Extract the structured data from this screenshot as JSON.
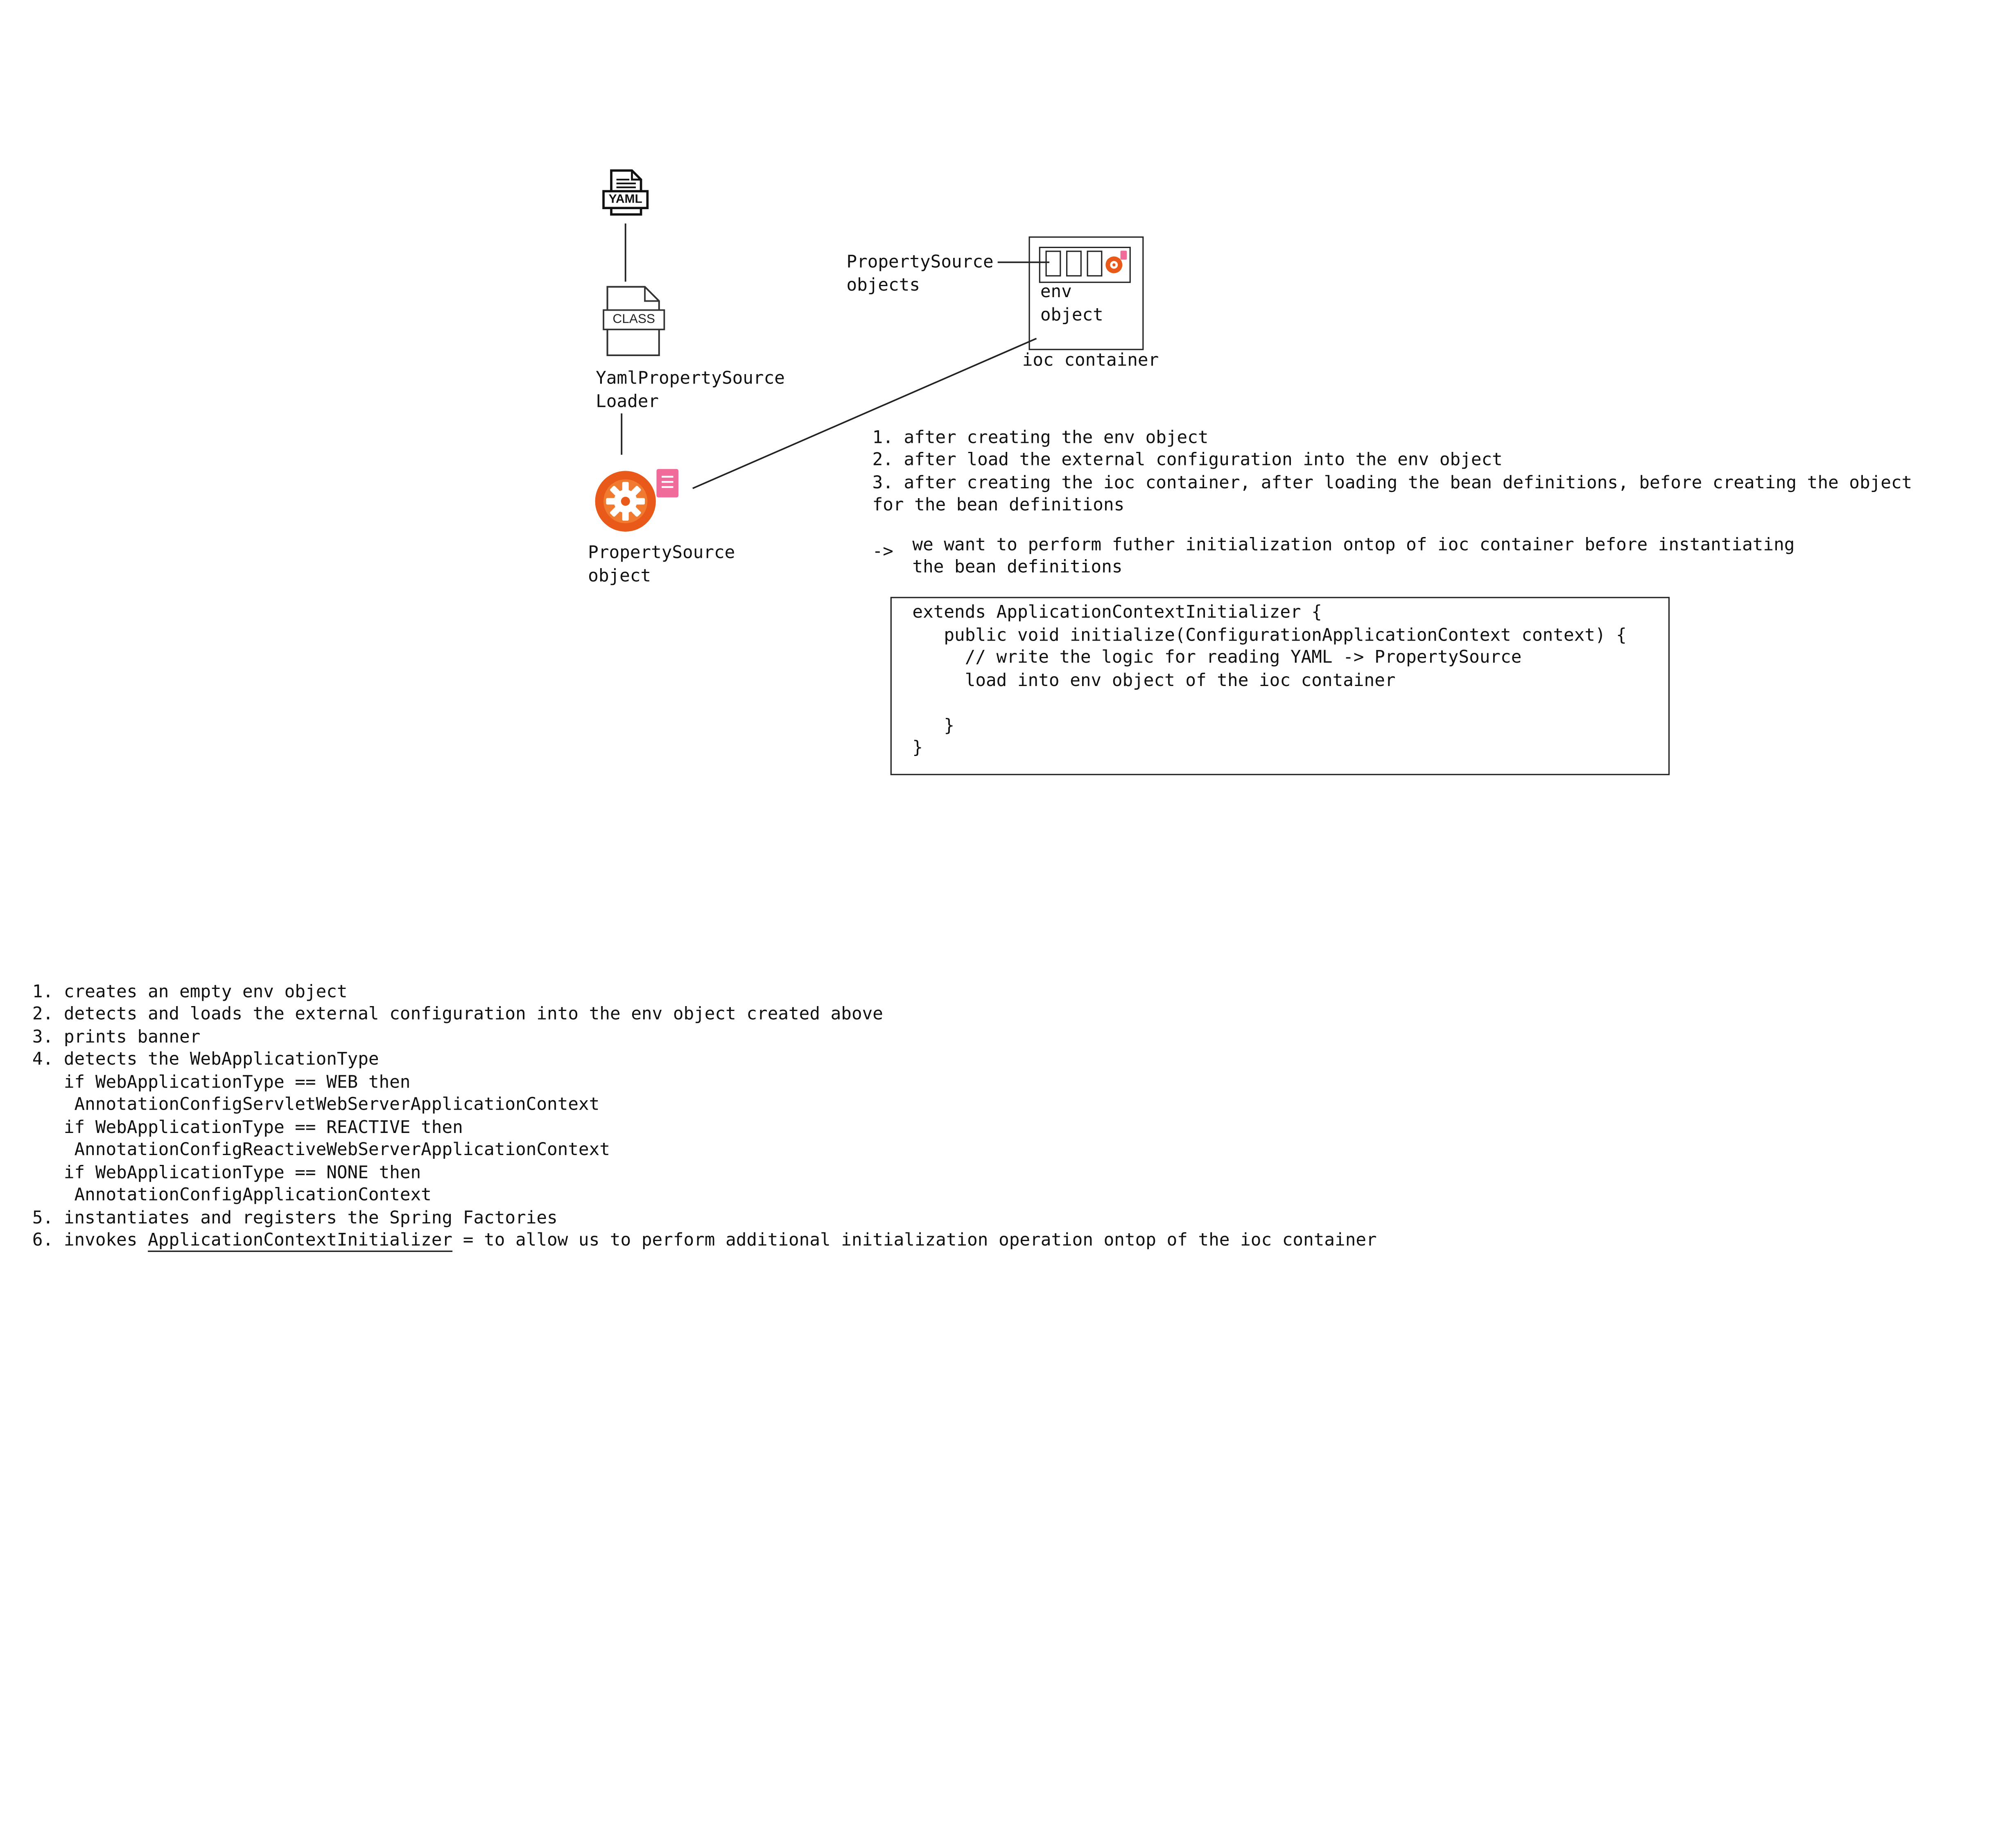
{
  "diagram": {
    "yaml_icon_label": "YAML",
    "class_icon_label": "CLASS",
    "loader_label": [
      "YamlPropertySource",
      "Loader"
    ],
    "propertysource_object_label": [
      "PropertySource",
      "object"
    ],
    "propertysource_objects_label": [
      "PropertySource",
      "objects"
    ],
    "env_object_label": [
      "env",
      "object"
    ],
    "ioc_container_label": "ioc container"
  },
  "notes": {
    "phases": [
      "1. after creating the env object",
      "2. after load the external configuration into the env object",
      "3. after creating the ioc container, after loading the bean definitions, before creating the object",
      "for the bean definitions"
    ],
    "arrow": "->",
    "intent": [
      "we want to perform futher initialization ontop of ioc container before instantiating",
      "the bean definitions"
    ]
  },
  "code_box": {
    "lines": [
      "extends ApplicationContextInitializer {",
      "   public void initialize(ConfigurationApplicationContext context) {",
      "     // write the logic for reading YAML -> PropertySource",
      "     load into env object of the ioc container",
      "",
      "   }",
      "}"
    ]
  },
  "steps": {
    "lines": [
      "1. creates an empty env object",
      "2. detects and loads the external configuration into the env object created above",
      "3. prints banner",
      "4. detects the WebApplicationType",
      "   if WebApplicationType == WEB then",
      "    AnnotationConfigServletWebServerApplicationContext",
      "   if WebApplicationType == REACTIVE then",
      "    AnnotationConfigReactiveWebServerApplicationContext",
      "   if WebApplicationType == NONE then",
      "    AnnotationConfigApplicationContext",
      "5. instantiates and registers the Spring Factories"
    ],
    "last_prefix": "6. invokes ",
    "last_link": "ApplicationContextInitializer",
    "last_suffix": " = to allow us to perform additional initialization operation ontop of the ioc container"
  },
  "colors": {
    "spring_orange": "#e8591a",
    "spring_orange_light": "#f28a3c",
    "note_pink": "#f06a9a",
    "line": "#222222"
  }
}
